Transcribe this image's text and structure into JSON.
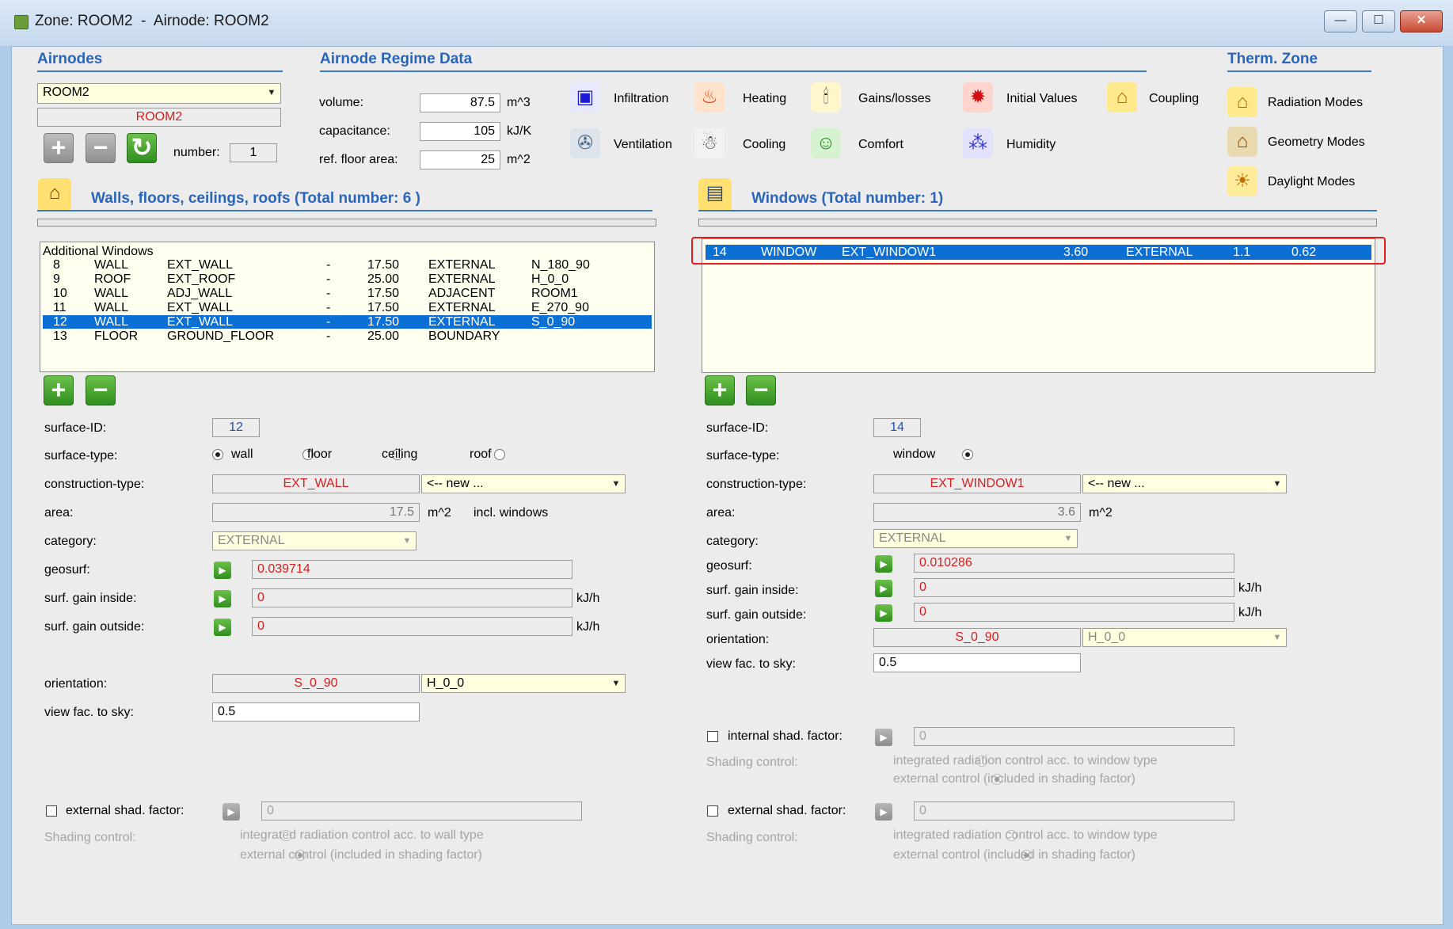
{
  "window": {
    "title": "Zone: ROOM2  -  Airnode: ROOM2",
    "minimize": "—",
    "maximize": "☐",
    "close": "✕"
  },
  "airnodes": {
    "header": "Airnodes",
    "selected": "ROOM2",
    "display": "ROOM2",
    "number_label": "number:",
    "number_value": "1",
    "add": "+",
    "remove": "−",
    "refresh": "↻"
  },
  "regime": {
    "header": "Airnode Regime Data",
    "volume_label": "volume:",
    "volume_value": "87.5",
    "volume_unit": "m^3",
    "capacitance_label": "capacitance:",
    "capacitance_value": "105",
    "capacitance_unit": "kJ/K",
    "floor_label": "ref. floor area:",
    "floor_value": "25",
    "floor_unit": "m^2",
    "infiltration": "Infiltration",
    "ventilation": "Ventilation",
    "heating": "Heating",
    "cooling": "Cooling",
    "gains": "Gains/losses",
    "comfort": "Comfort",
    "initial": "Initial Values",
    "humidity": "Humidity",
    "coupling": "Coupling"
  },
  "therm": {
    "header": "Therm. Zone",
    "radiation": "Radiation Modes",
    "geometry": "Geometry Modes",
    "daylight": "Daylight Modes"
  },
  "walls": {
    "header": "Walls, floors, ceilings, roofs (Total number: 6 )",
    "list_header": "Additional Windows",
    "rows": [
      {
        "id": "8",
        "type": "WALL",
        "cons": "EXT_WALL",
        "dash": "-",
        "area": "17.50",
        "cat": "EXTERNAL",
        "orient": "N_180_90"
      },
      {
        "id": "9",
        "type": "ROOF",
        "cons": "EXT_ROOF",
        "dash": "-",
        "area": "25.00",
        "cat": "EXTERNAL",
        "orient": "H_0_0"
      },
      {
        "id": "10",
        "type": "WALL",
        "cons": "ADJ_WALL",
        "dash": "-",
        "area": "17.50",
        "cat": "ADJACENT",
        "orient": "ROOM1"
      },
      {
        "id": "11",
        "type": "WALL",
        "cons": "EXT_WALL",
        "dash": "-",
        "area": "17.50",
        "cat": "EXTERNAL",
        "orient": "E_270_90"
      },
      {
        "id": "12",
        "type": "WALL",
        "cons": "EXT_WALL",
        "dash": "-",
        "area": "17.50",
        "cat": "EXTERNAL",
        "orient": "S_0_90"
      },
      {
        "id": "13",
        "type": "FLOOR",
        "cons": "GROUND_FLOOR",
        "dash": "-",
        "area": "25.00",
        "cat": "BOUNDARY",
        "orient": ""
      }
    ],
    "add": "+",
    "remove": "−",
    "surface_id_label": "surface-ID:",
    "surface_id": "12",
    "surface_type_label": "surface-type:",
    "type_wall": "wall",
    "type_floor": "floor",
    "type_ceiling": "ceiling",
    "type_roof": "roof",
    "construction_label": "construction-type:",
    "construction": "EXT_WALL",
    "construction_new": "<-- new ...",
    "area_label": "area:",
    "area": "17.5",
    "area_unit": "m^2",
    "area_note": "incl. windows",
    "category_label": "category:",
    "category": "EXTERNAL",
    "geosurf_label": "geosurf:",
    "geosurf": "0.039714",
    "gain_in_label": "surf. gain inside:",
    "gain_in": "0",
    "gain_in_unit": "kJ/h",
    "gain_out_label": "surf. gain outside:",
    "gain_out": "0",
    "gain_out_unit": "kJ/h",
    "orientation_label": "orientation:",
    "orientation": "S_0_90",
    "orientation_combo": "H_0_0",
    "viewfac_label": "view fac. to sky:",
    "viewfac": "0.5",
    "ext_shad_label": "external shad. factor:",
    "ext_shad_value": "0",
    "shading_label": "Shading control:",
    "shading_opt1": "integrated radiation control acc. to wall type",
    "shading_opt2": "external control (included in shading factor)"
  },
  "windows": {
    "header": "Windows (Total number: 1)",
    "rows": [
      {
        "id": "14",
        "type": "WINDOW",
        "cons": "EXT_WINDOW1",
        "area": "3.60",
        "cat": "EXTERNAL",
        "u": "1.1",
        "g": "0.62"
      }
    ],
    "add": "+",
    "remove": "−",
    "surface_id_label": "surface-ID:",
    "surface_id": "14",
    "surface_type_label": "surface-type:",
    "type_window": "window",
    "construction_label": "construction-type:",
    "construction": "EXT_WINDOW1",
    "construction_new": "<-- new ...",
    "area_label": "area:",
    "area": "3.6",
    "area_unit": "m^2",
    "category_label": "category:",
    "category": "EXTERNAL",
    "geosurf_label": "geosurf:",
    "geosurf": "0.010286",
    "gain_in_label": "surf. gain inside:",
    "gain_in": "0",
    "gain_in_unit": "kJ/h",
    "gain_out_label": "surf. gain outside:",
    "gain_out": "0",
    "gain_out_unit": "kJ/h",
    "orientation_label": "orientation:",
    "orientation": "S_0_90",
    "orientation_combo": "H_0_0",
    "viewfac_label": "view fac. to sky:",
    "viewfac": "0.5",
    "int_shad_label": "internal shad. factor:",
    "int_shad_value": "0",
    "int_shading_label": "Shading control:",
    "int_opt1": "integrated radiation control acc. to window type",
    "int_opt2": "external control (included in shading factor)",
    "ext_shad_label": "external shad. factor:",
    "ext_shad_value": "0",
    "ext_shading_label": "Shading control:",
    "ext_opt1": "integrated radiation control acc. to window type",
    "ext_opt2": "external control (included in shading factor)"
  }
}
